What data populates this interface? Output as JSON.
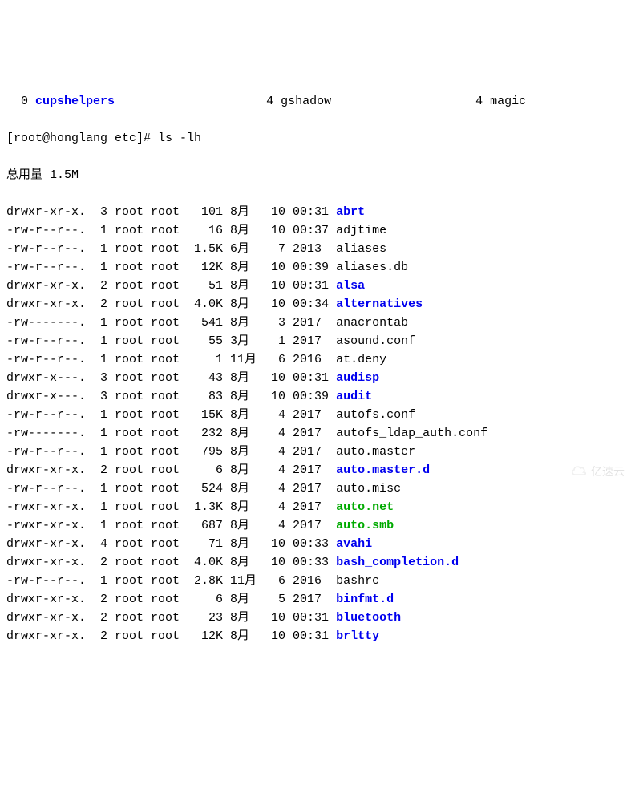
{
  "top_partials": [
    {
      "text_parts": [
        {
          "text": "  0 ",
          "cls": "black"
        },
        {
          "text": "cupshelpers",
          "cls": "blue"
        },
        {
          "text": "                     4 gshadow                    4 magic",
          "cls": "black"
        }
      ]
    }
  ],
  "prompt_line": {
    "prompt": "[root@honglang etc]# ",
    "command": "ls -lh"
  },
  "total_line": "总用量 1.5M",
  "listing": [
    {
      "perm": "drwxr-xr-x.",
      "links": "3",
      "owner": "root",
      "group": "root",
      "size": "101",
      "month": "8月",
      "day": "10",
      "time": "00:31",
      "name": "abrt",
      "cls": "blue"
    },
    {
      "perm": "-rw-r--r--.",
      "links": "1",
      "owner": "root",
      "group": "root",
      "size": "16",
      "month": "8月",
      "day": "10",
      "time": "00:37",
      "name": "adjtime",
      "cls": "black"
    },
    {
      "perm": "-rw-r--r--.",
      "links": "1",
      "owner": "root",
      "group": "root",
      "size": "1.5K",
      "month": "6月",
      "day": "7",
      "time": "2013",
      "name": "aliases",
      "cls": "black"
    },
    {
      "perm": "-rw-r--r--.",
      "links": "1",
      "owner": "root",
      "group": "root",
      "size": "12K",
      "month": "8月",
      "day": "10",
      "time": "00:39",
      "name": "aliases.db",
      "cls": "black"
    },
    {
      "perm": "drwxr-xr-x.",
      "links": "2",
      "owner": "root",
      "group": "root",
      "size": "51",
      "month": "8月",
      "day": "10",
      "time": "00:31",
      "name": "alsa",
      "cls": "blue"
    },
    {
      "perm": "drwxr-xr-x.",
      "links": "2",
      "owner": "root",
      "group": "root",
      "size": "4.0K",
      "month": "8月",
      "day": "10",
      "time": "00:34",
      "name": "alternatives",
      "cls": "blue"
    },
    {
      "perm": "-rw-------.",
      "links": "1",
      "owner": "root",
      "group": "root",
      "size": "541",
      "month": "8月",
      "day": "3",
      "time": "2017",
      "name": "anacrontab",
      "cls": "black"
    },
    {
      "perm": "-rw-r--r--.",
      "links": "1",
      "owner": "root",
      "group": "root",
      "size": "55",
      "month": "3月",
      "day": "1",
      "time": "2017",
      "name": "asound.conf",
      "cls": "black"
    },
    {
      "perm": "-rw-r--r--.",
      "links": "1",
      "owner": "root",
      "group": "root",
      "size": "1",
      "month": "11月",
      "day": "6",
      "time": "2016",
      "name": "at.deny",
      "cls": "black"
    },
    {
      "perm": "drwxr-x---.",
      "links": "3",
      "owner": "root",
      "group": "root",
      "size": "43",
      "month": "8月",
      "day": "10",
      "time": "00:31",
      "name": "audisp",
      "cls": "blue"
    },
    {
      "perm": "drwxr-x---.",
      "links": "3",
      "owner": "root",
      "group": "root",
      "size": "83",
      "month": "8月",
      "day": "10",
      "time": "00:39",
      "name": "audit",
      "cls": "blue"
    },
    {
      "perm": "-rw-r--r--.",
      "links": "1",
      "owner": "root",
      "group": "root",
      "size": "15K",
      "month": "8月",
      "day": "4",
      "time": "2017",
      "name": "autofs.conf",
      "cls": "black"
    },
    {
      "perm": "-rw-------.",
      "links": "1",
      "owner": "root",
      "group": "root",
      "size": "232",
      "month": "8月",
      "day": "4",
      "time": "2017",
      "name": "autofs_ldap_auth.conf",
      "cls": "black"
    },
    {
      "perm": "-rw-r--r--.",
      "links": "1",
      "owner": "root",
      "group": "root",
      "size": "795",
      "month": "8月",
      "day": "4",
      "time": "2017",
      "name": "auto.master",
      "cls": "black"
    },
    {
      "perm": "drwxr-xr-x.",
      "links": "2",
      "owner": "root",
      "group": "root",
      "size": "6",
      "month": "8月",
      "day": "4",
      "time": "2017",
      "name": "auto.master.d",
      "cls": "blue"
    },
    {
      "perm": "-rw-r--r--.",
      "links": "1",
      "owner": "root",
      "group": "root",
      "size": "524",
      "month": "8月",
      "day": "4",
      "time": "2017",
      "name": "auto.misc",
      "cls": "black"
    },
    {
      "perm": "-rwxr-xr-x.",
      "links": "1",
      "owner": "root",
      "group": "root",
      "size": "1.3K",
      "month": "8月",
      "day": "4",
      "time": "2017",
      "name": "auto.net",
      "cls": "green"
    },
    {
      "perm": "-rwxr-xr-x.",
      "links": "1",
      "owner": "root",
      "group": "root",
      "size": "687",
      "month": "8月",
      "day": "4",
      "time": "2017",
      "name": "auto.smb",
      "cls": "green"
    },
    {
      "perm": "drwxr-xr-x.",
      "links": "4",
      "owner": "root",
      "group": "root",
      "size": "71",
      "month": "8月",
      "day": "10",
      "time": "00:33",
      "name": "avahi",
      "cls": "blue"
    },
    {
      "perm": "drwxr-xr-x.",
      "links": "2",
      "owner": "root",
      "group": "root",
      "size": "4.0K",
      "month": "8月",
      "day": "10",
      "time": "00:33",
      "name": "bash_completion.d",
      "cls": "blue"
    },
    {
      "perm": "-rw-r--r--.",
      "links": "1",
      "owner": "root",
      "group": "root",
      "size": "2.8K",
      "month": "11月",
      "day": "6",
      "time": "2016",
      "name": "bashrc",
      "cls": "black"
    },
    {
      "perm": "drwxr-xr-x.",
      "links": "2",
      "owner": "root",
      "group": "root",
      "size": "6",
      "month": "8月",
      "day": "5",
      "time": "2017",
      "name": "binfmt.d",
      "cls": "blue"
    },
    {
      "perm": "drwxr-xr-x.",
      "links": "2",
      "owner": "root",
      "group": "root",
      "size": "23",
      "month": "8月",
      "day": "10",
      "time": "00:31",
      "name": "bluetooth",
      "cls": "blue"
    },
    {
      "perm": "drwxr-xr-x.",
      "links": "2",
      "owner": "root",
      "group": "root",
      "size": "12K",
      "month": "8月",
      "day": "10",
      "time": "00:31",
      "name": "brltty",
      "cls": "blue"
    }
  ],
  "watermark": "亿速云"
}
